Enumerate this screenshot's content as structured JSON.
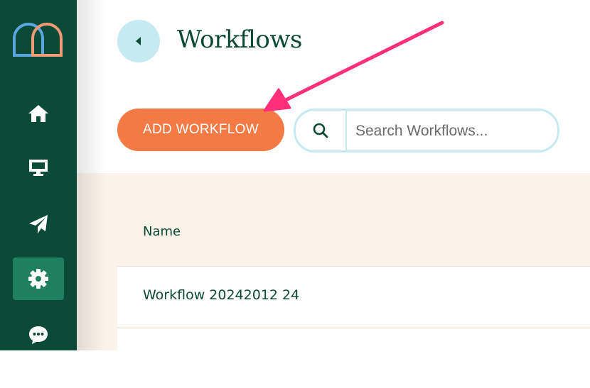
{
  "sidebar": {
    "items": [
      {
        "icon": "home-icon",
        "active": false
      },
      {
        "icon": "monitor-icon",
        "active": false
      },
      {
        "icon": "paper-plane-icon",
        "active": false
      },
      {
        "icon": "gear-icon",
        "active": true
      },
      {
        "icon": "chat-icon",
        "active": false
      }
    ]
  },
  "header": {
    "title": "Workflows"
  },
  "toolbar": {
    "add_label": "ADD WORKFLOW",
    "search_placeholder": "Search Workflows..."
  },
  "table": {
    "columns": [
      "Name"
    ],
    "rows": [
      {
        "name": "Workflow 20242012 24"
      },
      {
        "name": ""
      }
    ]
  },
  "colors": {
    "sidebar": "#0b4a37",
    "sidebar_active": "#1f8060",
    "accent": "#f47a45",
    "light_blue": "#c5eaf2",
    "content_bg": "#fbf3ea",
    "annotation_arrow": "#ff2f7a"
  }
}
